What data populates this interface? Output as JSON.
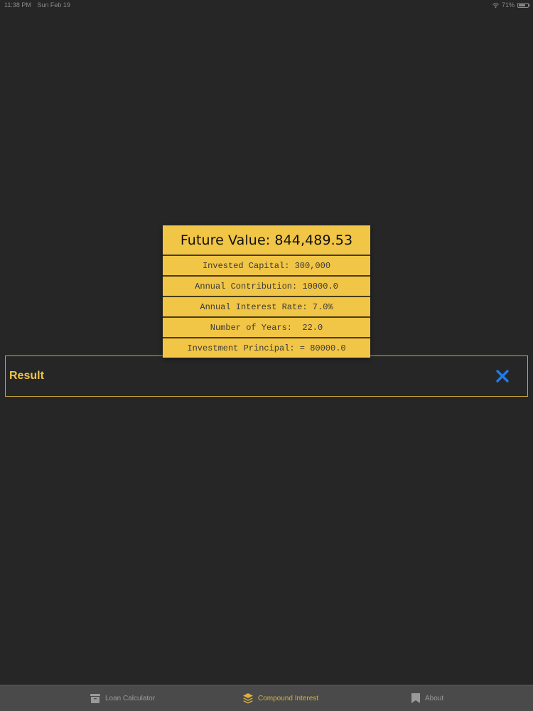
{
  "status_bar": {
    "time": "11:38 PM",
    "date": "Sun Feb 19",
    "battery": "71%",
    "battery_level": 0.71
  },
  "result_card": {
    "future_value": "Future Value: 844,489.53",
    "rows": [
      "Invested Capital: 300,000",
      "Annual Contribution: 10000.0",
      "Annual Interest Rate: 7.0%",
      "Number of Years:  22.0",
      "Investment Principal: = 80000.0"
    ]
  },
  "result_panel": {
    "title": "Result",
    "close_icon": "x-icon"
  },
  "tab_bar": {
    "items": [
      {
        "label": "Loan Calculator",
        "icon": "archive-box-icon",
        "active": false
      },
      {
        "label": "Compound Interest",
        "icon": "stacked-layers-icon",
        "active": true
      },
      {
        "label": "About",
        "icon": "bookmark-icon",
        "active": false
      }
    ]
  },
  "colors": {
    "background": "#262626",
    "card": "#f1c545",
    "accent": "#f1c545",
    "close": "#1a7cf0",
    "tab_bar": "#4a4a4a",
    "tab_active": "#d9b23b"
  }
}
